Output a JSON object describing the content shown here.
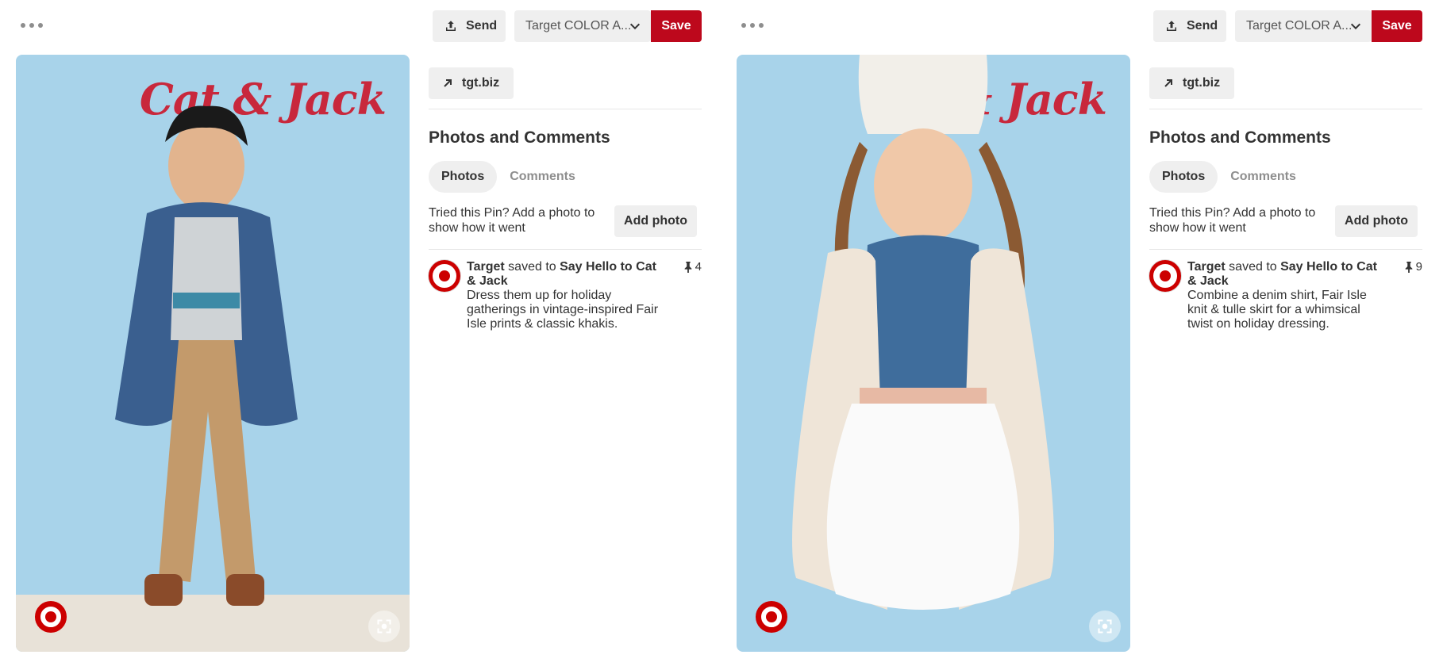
{
  "pins": [
    {
      "send_label": "Send",
      "board_label": "Target COLOR A...",
      "save_label": "Save",
      "brand_text": "Cat & Jack",
      "link_label": "tgt.biz",
      "section_title": "Photos and Comments",
      "tabs": [
        {
          "label": "Photos",
          "active": true
        },
        {
          "label": "Comments",
          "active": false
        }
      ],
      "tried_text": "Tried this Pin? Add a photo to show how it went",
      "add_photo_label": "Add photo",
      "comment": {
        "user": "Target",
        "saved_to_text": "saved to",
        "board": "Say Hello to Cat & Jack",
        "description": "Dress them up for holiday gatherings in vintage-inspired Fair Isle prints & classic khakis.",
        "repin_count": "4"
      }
    },
    {
      "send_label": "Send",
      "board_label": "Target COLOR A...",
      "save_label": "Save",
      "brand_text": "Cat & Jack",
      "link_label": "tgt.biz",
      "section_title": "Photos and Comments",
      "tabs": [
        {
          "label": "Photos",
          "active": true
        },
        {
          "label": "Comments",
          "active": false
        }
      ],
      "tried_text": "Tried this Pin? Add a photo to show how it went",
      "add_photo_label": "Add photo",
      "comment": {
        "user": "Target",
        "saved_to_text": "saved to",
        "board": "Say Hello to Cat & Jack",
        "description": "Combine a denim shirt, Fair Isle knit & tulle skirt for a whimsical twist on holiday dressing.",
        "repin_count": "9"
      }
    }
  ],
  "colors": {
    "save": "#bd081c",
    "target_red": "#cc0000",
    "image_bg": "#a8d3ea"
  },
  "icons": [
    "more-icon",
    "send-icon",
    "chevron-down-icon",
    "arrow-up-right-icon",
    "expand-icon",
    "pin-icon",
    "target-logo-icon"
  ]
}
